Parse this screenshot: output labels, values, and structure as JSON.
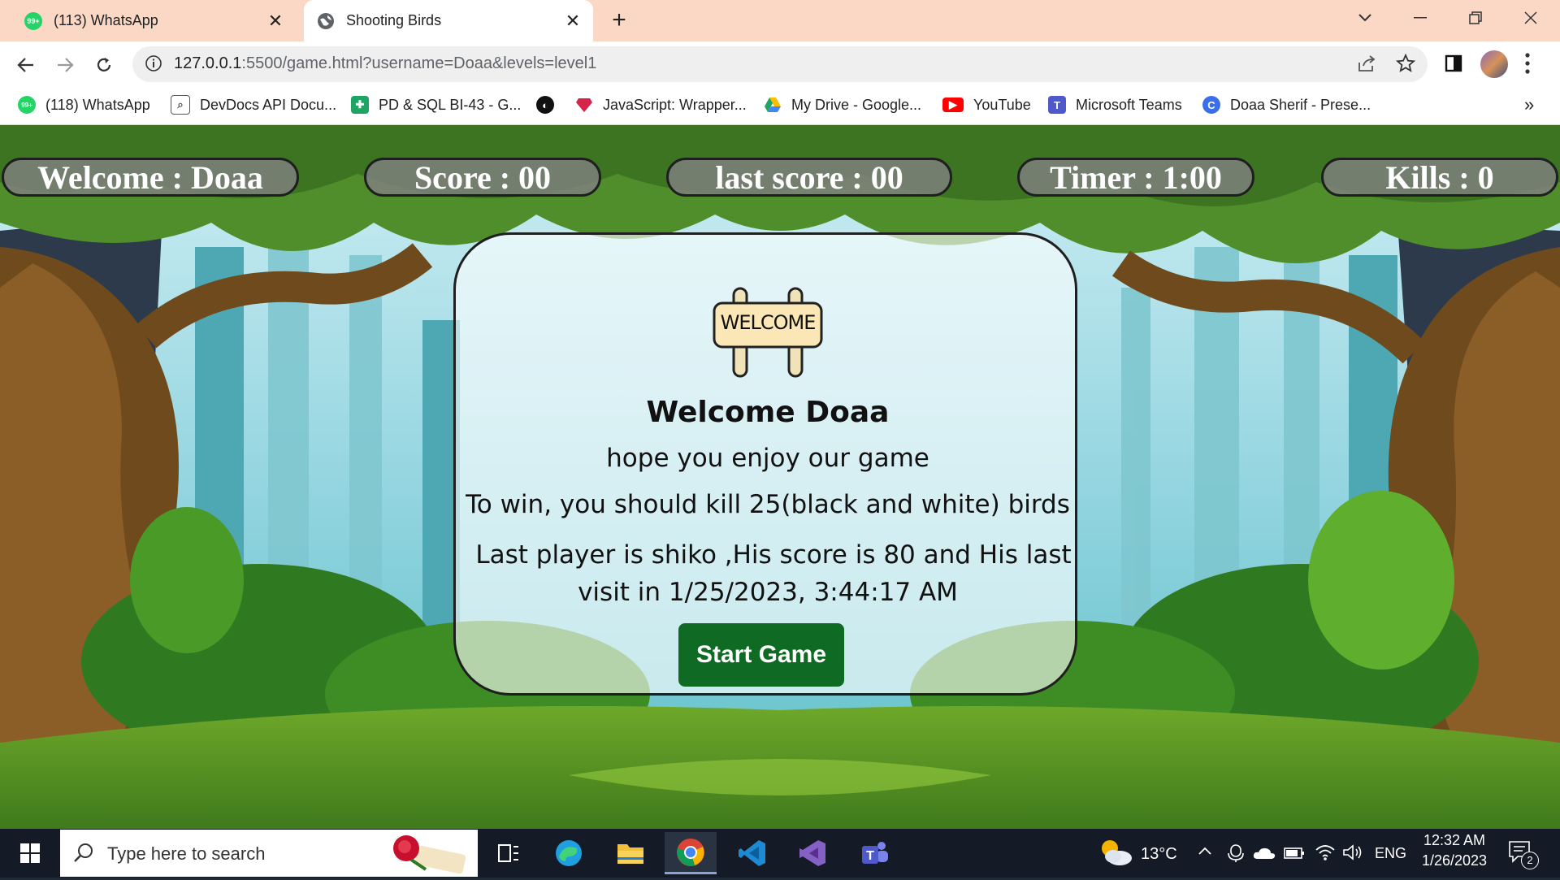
{
  "browser": {
    "tabs": [
      {
        "title": "(113) WhatsApp",
        "badge": "99+",
        "active": false
      },
      {
        "title": "Shooting Birds",
        "active": true
      }
    ],
    "new_tab_label": "+",
    "url": {
      "host": "127.0.0.1",
      "rest": ":5500/game.html?username=Doaa&levels=level1"
    },
    "bookmarks": [
      {
        "label": "(118) WhatsApp",
        "icon": "whatsapp-icon",
        "badge": "99+"
      },
      {
        "label": "DevDocs API Docu...",
        "icon": "devdocs-icon"
      },
      {
        "label": "PD & SQL BI-43 - G...",
        "icon": "sheets-icon"
      },
      {
        "label": "",
        "icon": "globe-icon"
      },
      {
        "label": "JavaScript: Wrapper...",
        "icon": "ruby-gem-icon"
      },
      {
        "label": "My Drive - Google...",
        "icon": "drive-icon"
      },
      {
        "label": "YouTube",
        "icon": "youtube-icon"
      },
      {
        "label": "Microsoft Teams",
        "icon": "teams-icon"
      },
      {
        "label": "Doaa Sherif - Prese...",
        "icon": "canva-icon"
      }
    ],
    "overflow_label": "»"
  },
  "hud": {
    "welcome": "Welcome : Doaa",
    "score": "Score : 00",
    "last_score": "last score : 00",
    "timer": "Timer : 1:00",
    "kills": "Kills : 0"
  },
  "panel": {
    "sign_text": "WELCOME",
    "heading": "Welcome Doaa",
    "subheading": "hope you enjoy our game",
    "rule": "To win, you should kill 25(black and white) birds",
    "last_player_line1": "Last player is shiko ,His score is 80 and His last",
    "last_player_line2": "visit in 1/25/2023, 3:44:17 AM",
    "start_button": "Start Game"
  },
  "taskbar": {
    "search_placeholder": "Type here to search",
    "weather": "13°C",
    "language": "ENG",
    "time": "12:32 AM",
    "date": "1/26/2023",
    "notification_count": "2"
  },
  "colors": {
    "tabstrip": "#fbd8c5",
    "start_button": "#0f6b23",
    "hud_fill": "#808080",
    "taskbar": "#141b26"
  }
}
